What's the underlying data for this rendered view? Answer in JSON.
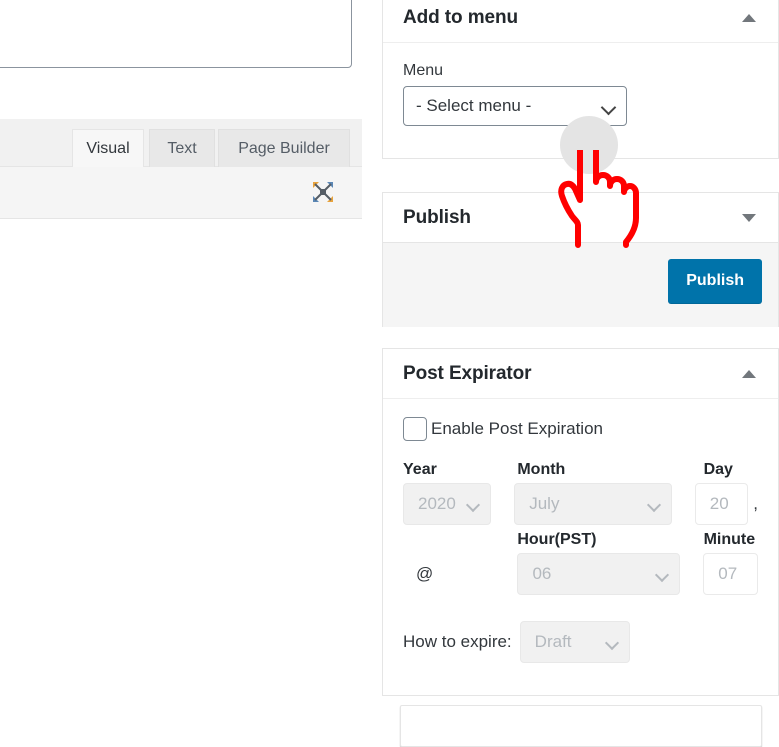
{
  "editor": {
    "tabs": [
      {
        "label": "Visual",
        "name": "tab-visual",
        "active": true
      },
      {
        "label": "Text",
        "name": "tab-text",
        "active": false
      },
      {
        "label": "Page Builder",
        "name": "tab-pagebuilder",
        "active": false
      }
    ],
    "expand_icon": "fullscreen-expand-icon"
  },
  "sidebar": {
    "add_to_menu": {
      "title": "Add to menu",
      "toggle_icon": "triangle-up-icon",
      "menu_label": "Menu",
      "menu_value": "- Select menu -",
      "chevron_icon": "chevron-down-icon"
    },
    "publish": {
      "title": "Publish",
      "toggle_icon": "triangle-down-icon",
      "button_label": "Publish",
      "accent_color": "#0073aa"
    },
    "post_expirator": {
      "title": "Post Expirator",
      "toggle_icon": "triangle-up-icon",
      "enable_label": "Enable Post Expiration",
      "enable_checked": false,
      "labels": {
        "year": "Year",
        "month": "Month",
        "day": "Day",
        "hour": "Hour(PST)",
        "minute": "Minute"
      },
      "values": {
        "year": "2020",
        "month": "July",
        "day": "20",
        "comma": ",",
        "at": "@",
        "hour": "06",
        "minute": "07"
      },
      "how_to_expire_label": "How to expire:",
      "how_to_expire_value": "Draft",
      "chevron_icon": "chevron-down-icon"
    }
  },
  "cursor": {
    "icon": "pointing-hand-cursor",
    "color": "#ff0000",
    "highlight_color": "#e4e4e4"
  }
}
